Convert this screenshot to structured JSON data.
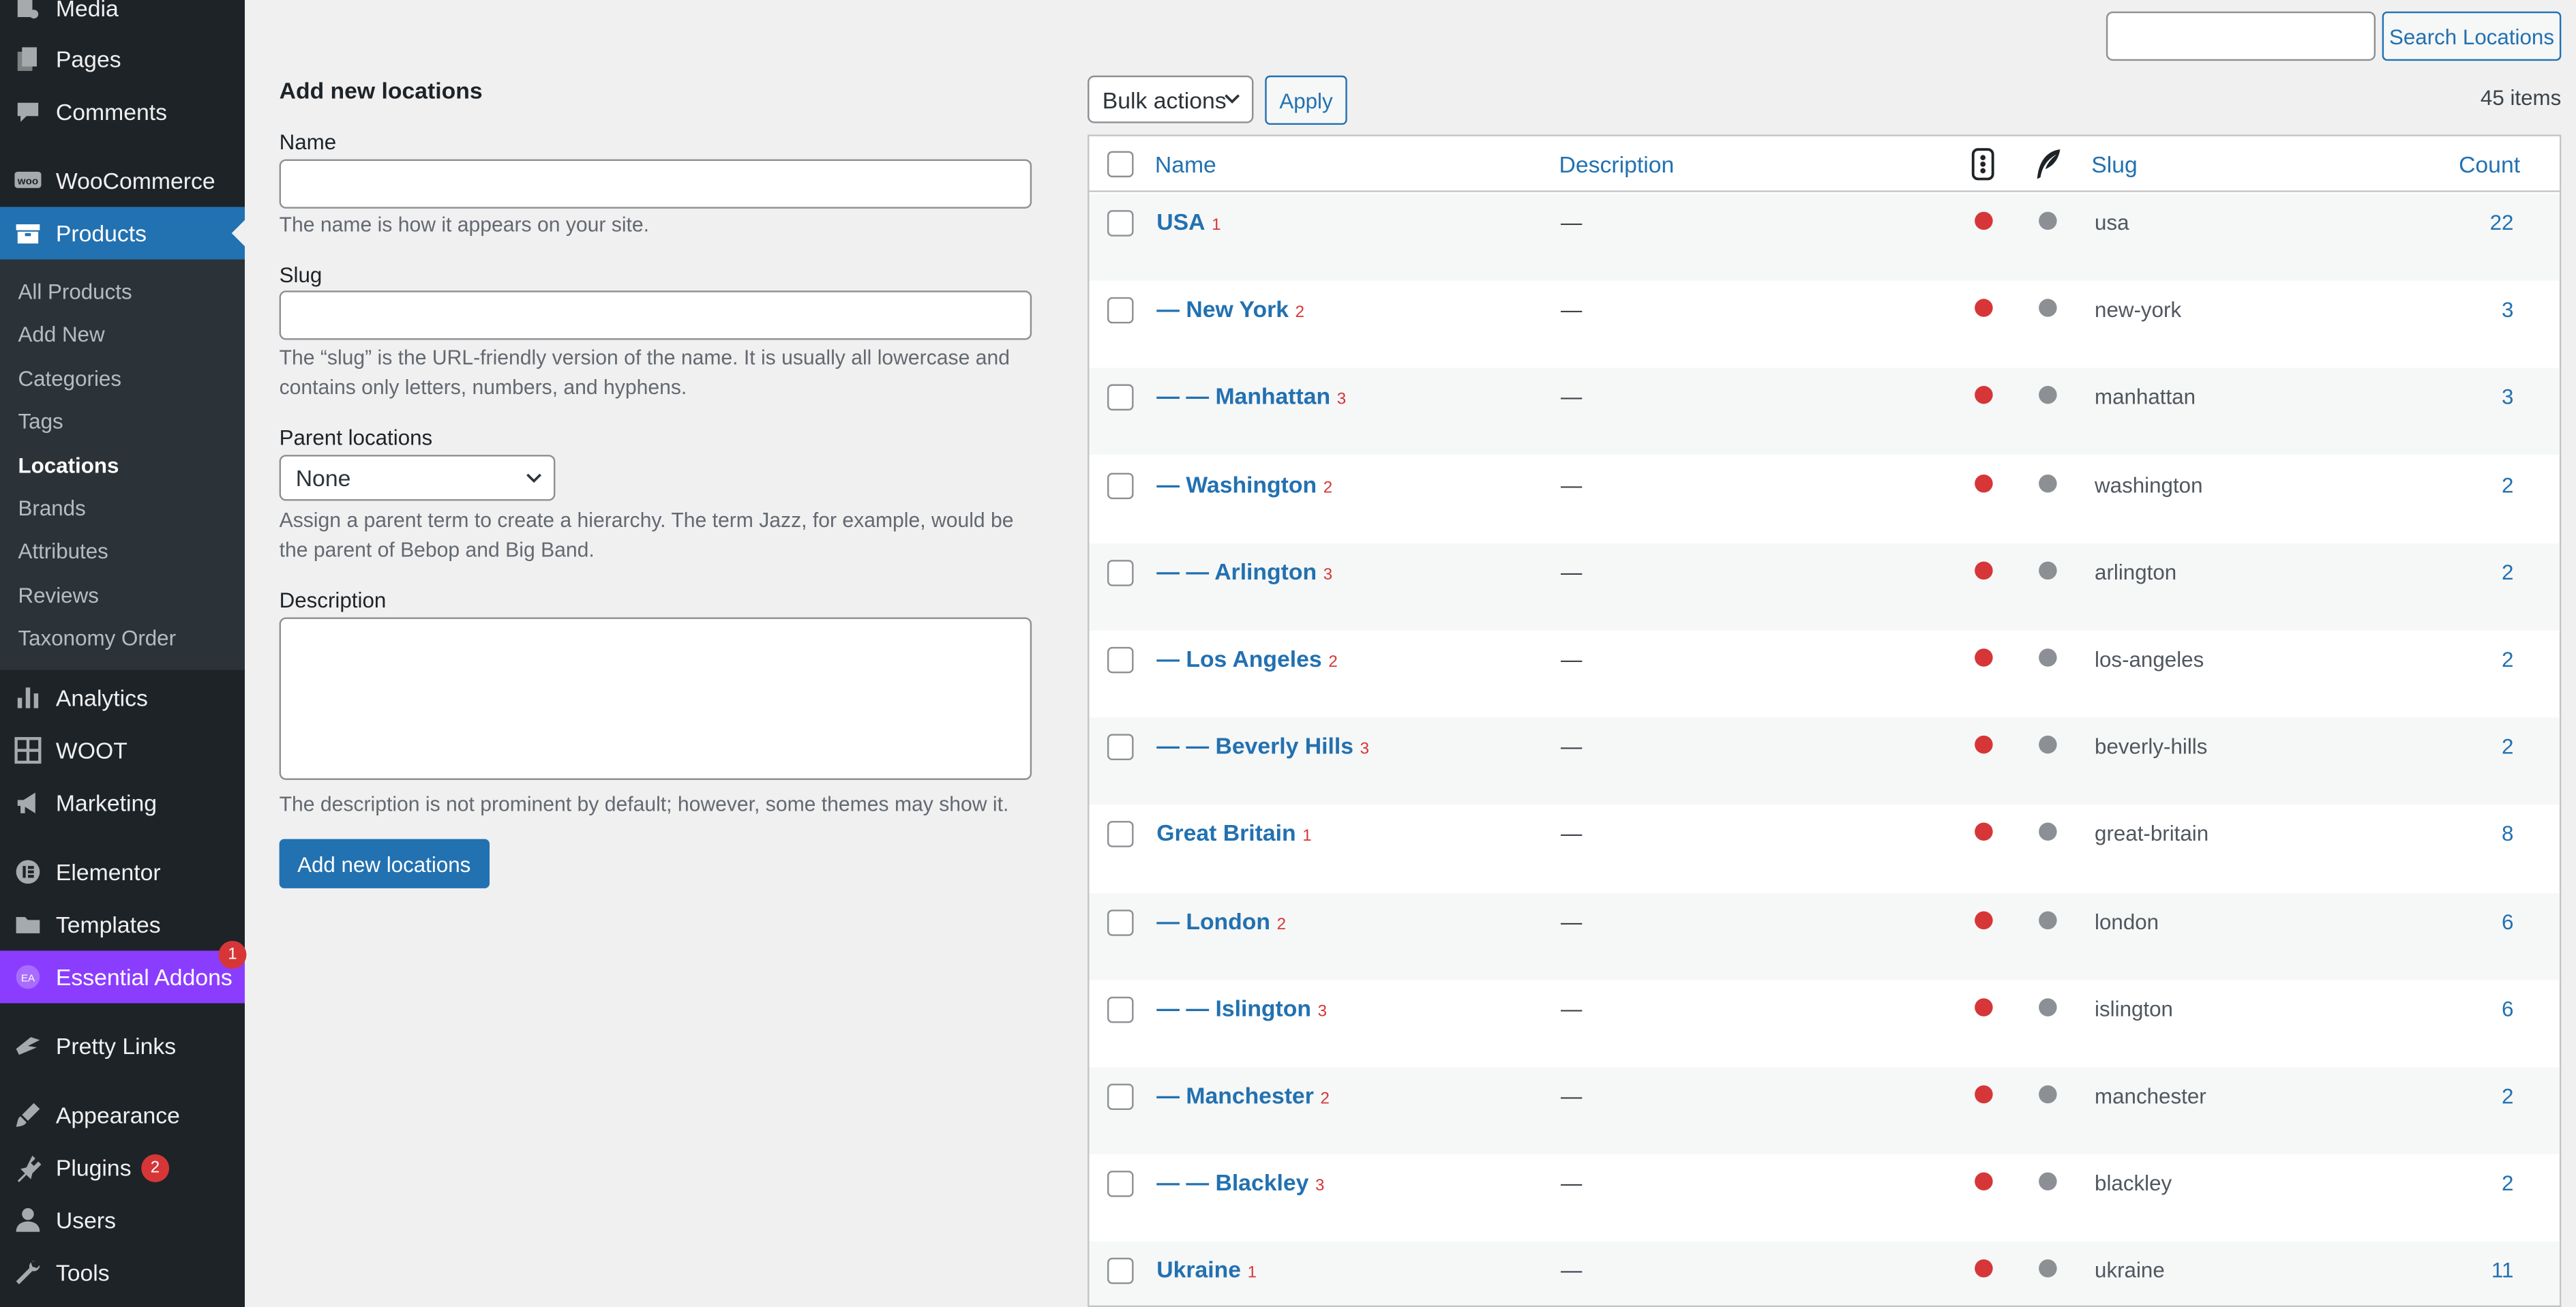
{
  "colors": {
    "sidebar_bg": "#1d2327",
    "accent": "#2271b1",
    "essential_addons": "#8b3dff",
    "status_red": "#d63638",
    "status_gray": "#8c8f94"
  },
  "sidebar": {
    "items": [
      {
        "label": "Media",
        "icon": "media-icon"
      },
      {
        "label": "Pages",
        "icon": "pages-icon"
      },
      {
        "label": "Comments",
        "icon": "comments-icon"
      },
      {
        "label": "WooCommerce",
        "icon": "woocommerce-icon"
      },
      {
        "label": "Products",
        "icon": "products-icon",
        "active": true
      },
      {
        "label": "Analytics",
        "icon": "analytics-icon"
      },
      {
        "label": "WOOT",
        "icon": "woot-grid-icon"
      },
      {
        "label": "Marketing",
        "icon": "marketing-icon"
      },
      {
        "label": "Elementor",
        "icon": "elementor-icon"
      },
      {
        "label": "Templates",
        "icon": "templates-icon"
      },
      {
        "label": "Essential Addons",
        "icon": "essential-addons-icon",
        "badge": "1"
      },
      {
        "label": "Pretty Links",
        "icon": "pretty-links-icon"
      },
      {
        "label": "Appearance",
        "icon": "appearance-icon"
      },
      {
        "label": "Plugins",
        "icon": "plugins-icon",
        "badge": "2"
      },
      {
        "label": "Users",
        "icon": "users-icon"
      },
      {
        "label": "Tools",
        "icon": "tools-icon"
      }
    ],
    "submenu": [
      "All Products",
      "Add New",
      "Categories",
      "Tags",
      "Locations",
      "Brands",
      "Attributes",
      "Reviews",
      "Taxonomy Order"
    ],
    "submenu_current": "Locations"
  },
  "form": {
    "title": "Add new locations",
    "name_label": "Name",
    "name_help": "The name is how it appears on your site.",
    "slug_label": "Slug",
    "slug_help": "The “slug” is the URL-friendly version of the name. It is usually all lowercase and contains only letters, numbers, and hyphens.",
    "parent_label": "Parent locations",
    "parent_value": "None",
    "parent_help": "Assign a parent term to create a hierarchy. The term Jazz, for example, would be the parent of Bebop and Big Band.",
    "description_label": "Description",
    "description_help": "The description is not prominent by default; however, some themes may show it.",
    "submit_label": "Add new locations"
  },
  "toolbar": {
    "search_button": "Search Locations",
    "bulk_value": "Bulk actions",
    "apply_label": "Apply",
    "items_count": "45 items"
  },
  "table": {
    "columns": {
      "name": "Name",
      "description": "Description",
      "slug": "Slug",
      "count": "Count"
    },
    "rows": [
      {
        "name": "USA",
        "level": "1",
        "desc": "—",
        "slug": "usa",
        "count": "22"
      },
      {
        "name": "— New York",
        "level": "2",
        "desc": "—",
        "slug": "new-york",
        "count": "3"
      },
      {
        "name": "— — Manhattan",
        "level": "3",
        "desc": "—",
        "slug": "manhattan",
        "count": "3"
      },
      {
        "name": "— Washington",
        "level": "2",
        "desc": "—",
        "slug": "washington",
        "count": "2"
      },
      {
        "name": "— — Arlington",
        "level": "3",
        "desc": "—",
        "slug": "arlington",
        "count": "2"
      },
      {
        "name": "— Los Angeles",
        "level": "2",
        "desc": "—",
        "slug": "los-angeles",
        "count": "2"
      },
      {
        "name": "— — Beverly Hills",
        "level": "3",
        "desc": "—",
        "slug": "beverly-hills",
        "count": "2"
      },
      {
        "name": "Great Britain",
        "level": "1",
        "desc": "—",
        "slug": "great-britain",
        "count": "8"
      },
      {
        "name": "— London",
        "level": "2",
        "desc": "—",
        "slug": "london",
        "count": "6"
      },
      {
        "name": "— — Islington",
        "level": "3",
        "desc": "—",
        "slug": "islington",
        "count": "6"
      },
      {
        "name": "— Manchester",
        "level": "2",
        "desc": "—",
        "slug": "manchester",
        "count": "2"
      },
      {
        "name": "— — Blackley",
        "level": "3",
        "desc": "—",
        "slug": "blackley",
        "count": "2"
      },
      {
        "name": "Ukraine",
        "level": "1",
        "desc": "—",
        "slug": "ukraine",
        "count": "11"
      }
    ]
  }
}
